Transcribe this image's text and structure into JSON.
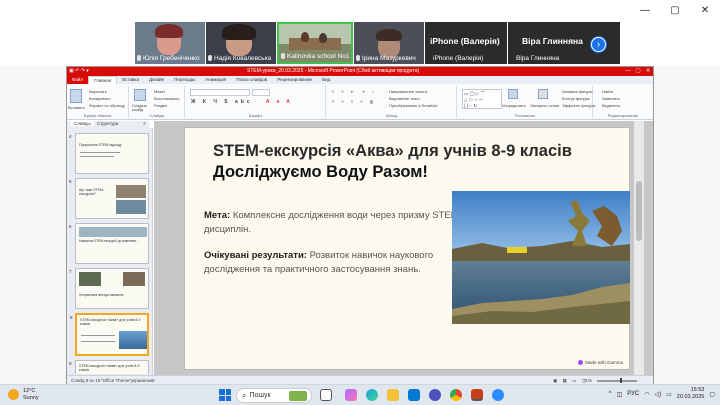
{
  "call": {
    "window_controls": [
      "—",
      "▢",
      "✕"
    ],
    "tiles": [
      {
        "name": "Юлія Гребеніченко",
        "bg": "#6b7b8c"
      },
      {
        "name": "Надія Ковалевська",
        "bg": "#3a3f4a"
      },
      {
        "name": "Kalinovka school No1",
        "bg": "#7e8a6a"
      },
      {
        "name": "Ірина Мазуркевич",
        "bg": "#4c4f58"
      },
      {
        "name": "iPhone (Валерія)",
        "big": "iPhone (Валерія)",
        "bg": "#2b2b2b"
      },
      {
        "name": "Віра Глинняна",
        "big": "Віра Глинняна",
        "bg": "#2b2b2b"
      }
    ],
    "next_icon": "chevron-right-icon"
  },
  "ppt": {
    "title": "STEM-уроки_20.03.2025 - Microsoft PowerPoint (Сбой активации продукта)",
    "window_controls": [
      "—",
      "▢",
      "✕"
    ],
    "tabs": [
      "Файл",
      "Главная",
      "Вставка",
      "Дизайн",
      "Переходы",
      "Анимация",
      "Показ слайдов",
      "Рецензирование",
      "Вид"
    ],
    "selected_tab": "Главная",
    "ribbon": {
      "groups": [
        "Буфер обмена",
        "Слайды",
        "Шрифт",
        "Абзац",
        "Рисование",
        "Редактирование"
      ],
      "clipboard": [
        "Вставить",
        "Вырезать",
        "Копировать",
        "Формат по образцу"
      ],
      "slides": [
        "Создать слайд",
        "Макет",
        "Восстановить",
        "Раздел"
      ],
      "paragraph": [
        "Направление текста",
        "Выровнять текст",
        "Преобразовать в SmartArt"
      ],
      "drawing": [
        "Упорядочить",
        "Экспресс-стили",
        "Заливка фигуры",
        "Контур фигуры",
        "Эффекты фигуры"
      ],
      "editing": [
        "Найти",
        "Заменить",
        "Выделить"
      ]
    },
    "panel_tabs": [
      "Слайды",
      "Структура"
    ],
    "thumbs": [
      {
        "n": "4",
        "label": "Порушення STEM-підходу"
      },
      {
        "n": "5",
        "label": "Що таке STEM-екскурсія?"
      },
      {
        "n": "6",
        "label": "Навчання STEM-екскурсії до вивчення..."
      },
      {
        "n": "7",
        "label": "Інтерактивні методи навчання"
      },
      {
        "n": "8",
        "label": "STEM-екскурсія «Аква» для учнів 8-9 класів"
      },
      {
        "n": "9",
        "label": "STEM-екскурсія «Аква» для учнів 8-9 класів"
      }
    ],
    "status": {
      "slide": "Слайд 8 из 19",
      "theme": "\"Office Theme\"",
      "lang": "украинский",
      "zoom": "71%"
    }
  },
  "slide": {
    "title_line1": "STEM-екскурсія «Аква» для учнів 8-9 класів",
    "title_line2": "Досліджуємо Воду Разом!",
    "goal_label": "Мета:",
    "goal_text": "Комплексне дослідження води через призму STEM-дисциплін.",
    "results_label": "Очікувані результати:",
    "results_text": "Розвиток навичок наукового дослідження та практичного застосування знань.",
    "badge": "Made with Gamma"
  },
  "taskbar": {
    "weather_temp": "12°C",
    "weather_text": "Sunny",
    "search_placeholder": "Пошук",
    "lang": "РУС",
    "time": "15:53",
    "date": "20.03.2025",
    "apps": [
      "files-icon",
      "edge-icon",
      "folder-icon",
      "store-icon",
      "teams-icon",
      "chrome-icon",
      "powerpoint-icon",
      "zoom-icon"
    ]
  }
}
